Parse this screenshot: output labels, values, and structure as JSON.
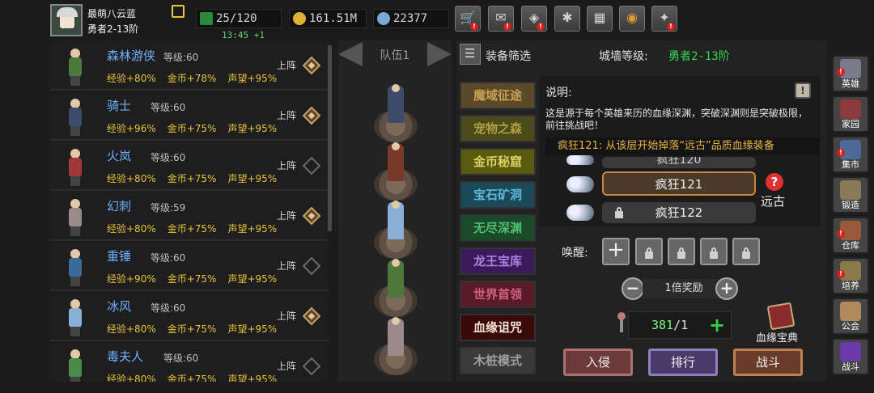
{
  "header": {
    "player_name": "最萌八云蓝",
    "player_rank": "勇者2-13阶",
    "stamina": "25/120",
    "stamina_timer": "13:45 +1",
    "gold": "161.51M",
    "gems": "22377"
  },
  "heroes": [
    {
      "name": "森林游侠",
      "level": "等级:60",
      "exp": "经验+80%",
      "gold": "金币+78%",
      "fame": "声望+95%",
      "deploy": "上阵",
      "deployed": true,
      "color": "#4c7a3a"
    },
    {
      "name": "骑士",
      "level": "等级:60",
      "exp": "经验+96%",
      "gold": "金币+75%",
      "fame": "声望+95%",
      "deploy": "上阵",
      "deployed": true,
      "color": "#3c4c6a"
    },
    {
      "name": "火岚",
      "level": "等级:60",
      "exp": "经验+80%",
      "gold": "金币+75%",
      "fame": "声望+95%",
      "deploy": "上阵",
      "deployed": false,
      "color": "#a23838"
    },
    {
      "name": "幻刺",
      "level": "等级:59",
      "exp": "经验+80%",
      "gold": "金币+75%",
      "fame": "声望+95%",
      "deploy": "上阵",
      "deployed": true,
      "color": "#9a8a8a"
    },
    {
      "name": "重锤",
      "level": "等级:60",
      "exp": "经验+90%",
      "gold": "金币+75%",
      "fame": "声望+95%",
      "deploy": "上阵",
      "deployed": false,
      "color": "#3a6a9a"
    },
    {
      "name": "冰风",
      "level": "等级:60",
      "exp": "经验+80%",
      "gold": "金币+75%",
      "fame": "声望+95%",
      "deploy": "上阵",
      "deployed": true,
      "color": "#8ab0d8"
    },
    {
      "name": "毒夫人",
      "level": "等级:60",
      "exp": "经验+80%",
      "gold": "金币+75%",
      "fame": "声望+95%",
      "deploy": "上阵",
      "deployed": false,
      "color": "#4a8a4a"
    }
  ],
  "team": {
    "label": "队伍1",
    "members": [
      "#3c4c6a",
      "#7a3a2a",
      "#8ab0d8",
      "#4c7a3a",
      "#9a8a8a"
    ]
  },
  "panel": {
    "filter_label": "装备筛选",
    "wall_label": "城墙等级:",
    "wall_value": "勇者2-13阶",
    "modes": [
      {
        "label": "魔域征途",
        "bg": "#5a4a2a",
        "fg": "#c8a050"
      },
      {
        "label": "宠物之森",
        "bg": "#4a4a1a",
        "fg": "#b0a040"
      },
      {
        "label": "金币秘窟",
        "bg": "#5a5a10",
        "fg": "#d8d060"
      },
      {
        "label": "宝石矿洞",
        "bg": "#1a4a5a",
        "fg": "#60b8d8"
      },
      {
        "label": "无尽深渊",
        "bg": "#1a4a2a",
        "fg": "#50c070"
      },
      {
        "label": "龙王宝库",
        "bg": "#3a1a5a",
        "fg": "#b080e0"
      },
      {
        "label": "世界首领",
        "bg": "#5a1a2a",
        "fg": "#d06080"
      },
      {
        "label": "血缘诅咒",
        "bg": "#3a0a0a",
        "fg": "#f0e0d0"
      },
      {
        "label": "木桩模式",
        "bg": "#3a3a3a",
        "fg": "#a0a0a0"
      }
    ],
    "desc_title": "说明:",
    "desc_text": "这是源于每个英雄来历的血缘深渊，突破深渊则是突破极限，前往挑战吧！",
    "notice": "疯狂121: 从该层开始掉落“远古”品质血缘装备",
    "depth_prev": "疯狂120",
    "depth_current": "疯狂121",
    "depth_next": "疯狂122",
    "grade": "远古",
    "awaken_label": "唤醒:",
    "reward_mult": "1倍奖励",
    "key_count": "381",
    "key_max": "/1",
    "book_label": "血缘宝典",
    "actions": [
      {
        "label": "入侵",
        "bg": "#6a3a3a",
        "border": "#b07070"
      },
      {
        "label": "排行",
        "bg": "#4a3a6a",
        "border": "#9080c0"
      },
      {
        "label": "战斗",
        "bg": "#6a3a2a",
        "border": "#c08050"
      }
    ]
  },
  "sidebar": [
    {
      "label": "英雄",
      "art": "#7a7a8a",
      "alert": true
    },
    {
      "label": "家园",
      "art": "#8a3a3a",
      "alert": false
    },
    {
      "label": "集市",
      "art": "#4a6a9a",
      "alert": true
    },
    {
      "label": "锻造",
      "art": "#8a7a5a",
      "alert": false
    },
    {
      "label": "仓库",
      "art": "#9a5a3a",
      "alert": true
    },
    {
      "label": "培养",
      "art": "#8a7a4a",
      "alert": true
    },
    {
      "label": "公会",
      "art": "#b08a5a",
      "alert": false
    },
    {
      "label": "战斗",
      "art": "#6a3aaa",
      "alert": false
    }
  ],
  "toolbar_icons": [
    "shop-icon",
    "mail-icon",
    "ticket-icon",
    "settings-icon",
    "gift-icon",
    "color-wheel-icon",
    "lantern-icon"
  ]
}
